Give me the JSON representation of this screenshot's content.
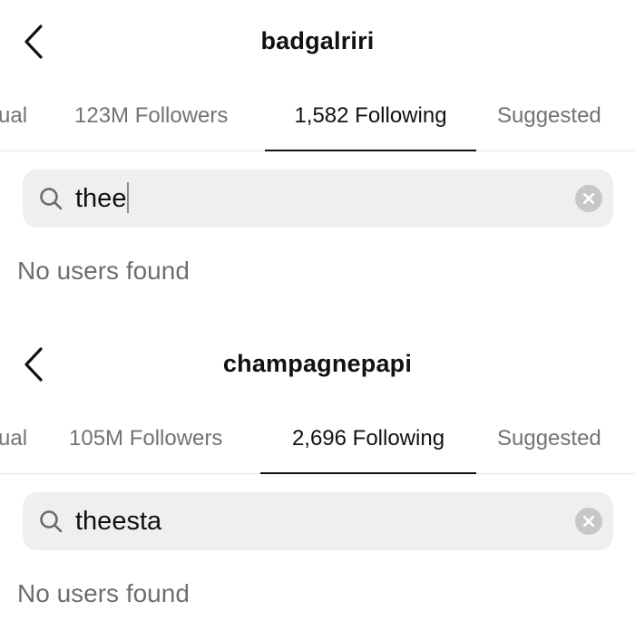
{
  "screens": [
    {
      "username": "badgalriri",
      "tabs": [
        "ual",
        "123M Followers",
        "1,582 Following",
        "Suggested"
      ],
      "active_tab": 2,
      "search": {
        "value": "thee",
        "caret": true
      },
      "result": "No users found"
    },
    {
      "username": "champagnepapi",
      "tabs": [
        "ual",
        "105M Followers",
        "2,696 Following",
        "Suggested"
      ],
      "active_tab": 2,
      "search": {
        "value": "theesta",
        "caret": false
      },
      "result": "No users found"
    }
  ],
  "icons": {
    "back": "chevron-left-icon",
    "search": "search-icon",
    "clear": "clear-circle-icon"
  },
  "colors": {
    "text": "#111111",
    "muted": "#737373",
    "search_bg": "#efefef",
    "clear_icon": "#c7c7c7"
  }
}
